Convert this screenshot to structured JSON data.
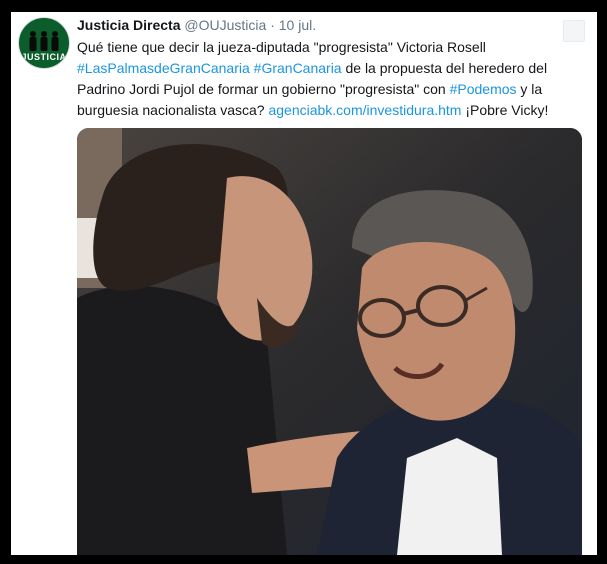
{
  "tweet": {
    "author_name": "Justicia Directa",
    "handle": "@OUJusticia",
    "separator": "·",
    "time": "10 jul.",
    "text_parts": [
      {
        "text": "Qué tiene que decir la jueza-diputada \"progresista\" Victoria Rosell ",
        "link": false
      },
      {
        "text": "#LasPalmasdeGranCanaria",
        "link": true
      },
      {
        "text": " ",
        "link": false
      },
      {
        "text": "#GranCanaria",
        "link": true
      },
      {
        "text": " de la propuesta del heredero del Padrino Jordi Pujol de formar un gobierno \"progresista\" con ",
        "link": false
      },
      {
        "text": "#Podemos",
        "link": true
      },
      {
        "text": " y la burguesia nacionalista vasca? ",
        "link": false
      },
      {
        "text": "agenciabk.com/investidura.htm",
        "link": true
      },
      {
        "text": " ¡Pobre Vicky!",
        "link": false
      }
    ],
    "avatar_logo_text": "JUSTICIA",
    "avatar_icon": "three-figures-logo",
    "caret_icon": "chevron-down-icon",
    "media_description_icon": "photo-two-men-embracing"
  },
  "colors": {
    "link": "#1b95e0",
    "text": "#14171a",
    "muted": "#657786",
    "avatar_bg": "#0b5e2b"
  }
}
